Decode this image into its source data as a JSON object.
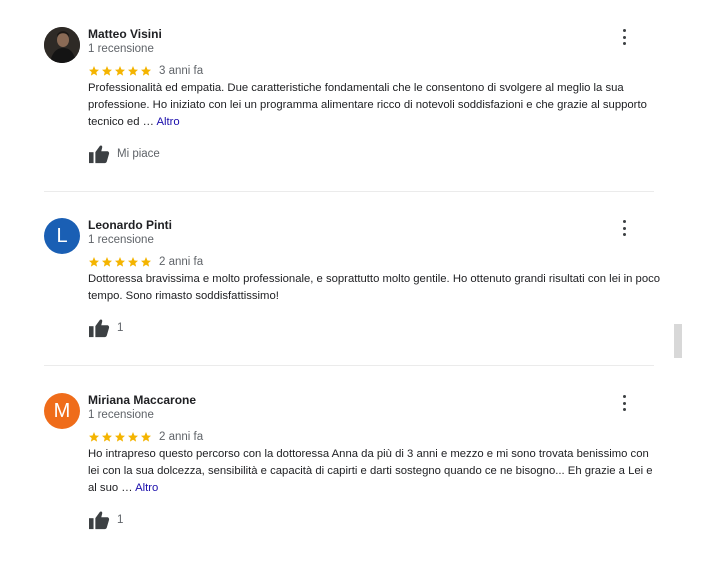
{
  "reviews": [
    {
      "author": "Matteo Visini",
      "count": "1 recensione",
      "stars": 5,
      "date": "3 anni fa",
      "text": "Professionalità ed empatia. Due caratteristiche fondamentali che le consentono di svolgere al meglio la sua professione. Ho iniziato con lei un programma alimentare ricco di notevoli soddisfazioni e che grazie al supporto tecnico ed … ",
      "more": "Altro",
      "like": "Mi piace",
      "avatar_letter": ""
    },
    {
      "author": "Leonardo Pinti",
      "count": "1 recensione",
      "stars": 5,
      "date": "2 anni fa",
      "text": "Dottoressa bravissima e molto professionale, e soprattutto molto gentile. Ho ottenuto grandi risultati con lei in poco tempo. Sono rimasto soddisfattissimo!",
      "like": "1",
      "avatar_letter": "L"
    },
    {
      "author": "Miriana Maccarone",
      "count": "1 recensione",
      "stars": 5,
      "date": "2 anni fa",
      "text": "Ho intrapreso questo percorso con la dottoressa Anna da più di 3 anni e mezzo e mi sono trovata benissimo con lei con la sua dolcezza, sensibilità e capacità di capirti e darti sostegno quando ce ne bisogno... Eh grazie a Lei e al suo … ",
      "more": "Altro",
      "like": "1",
      "avatar_letter": "M"
    }
  ],
  "colors": {
    "star": "#f4b400",
    "link": "#1a0dab",
    "avatar_blue": "#1a5fb4",
    "avatar_orange": "#ef6c1a"
  },
  "icons": [
    "kebab-menu-icon",
    "thumbs-up-icon",
    "star-icon"
  ]
}
